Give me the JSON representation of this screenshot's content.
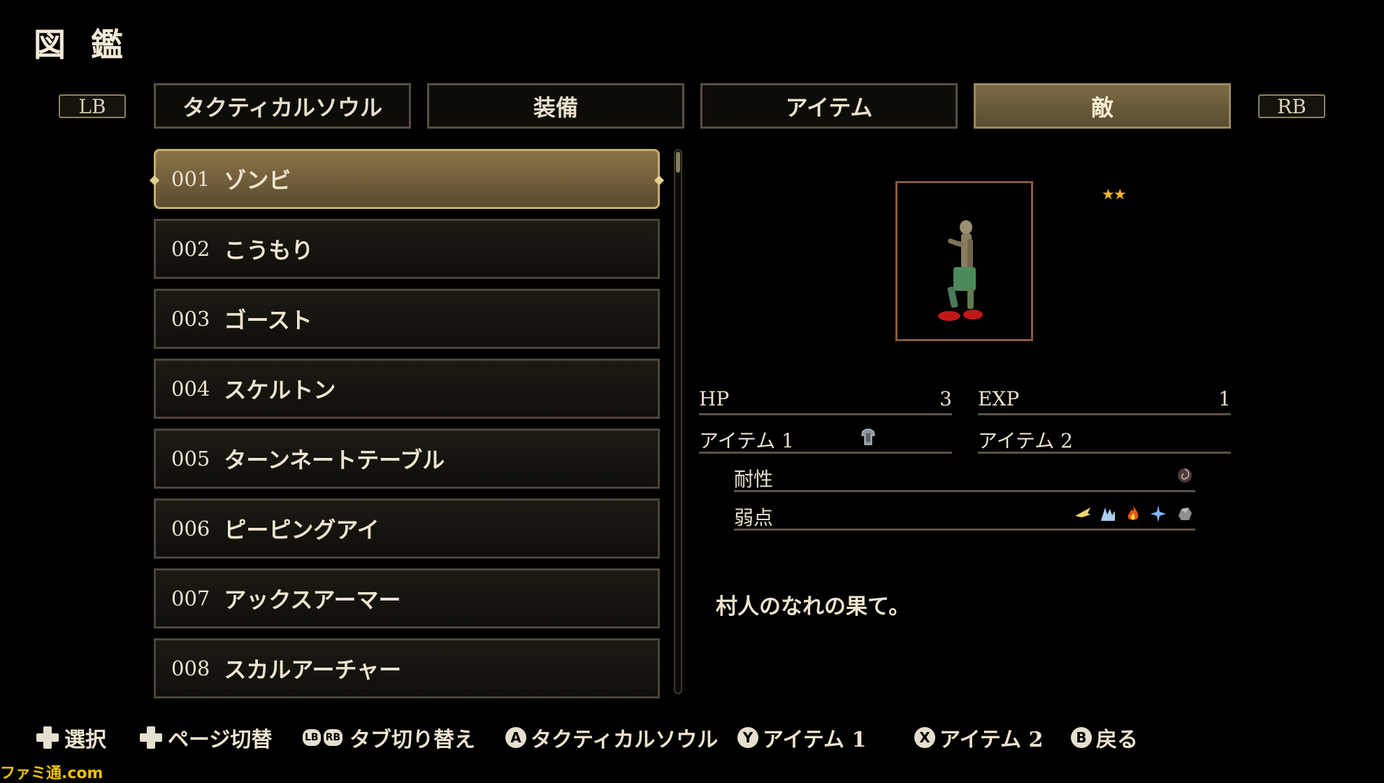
{
  "screen_title": "図 鑑",
  "bumpers": {
    "left": "LB",
    "right": "RB"
  },
  "tabs": [
    {
      "label": "タクティカルソウル"
    },
    {
      "label": "装備"
    },
    {
      "label": "アイテム"
    },
    {
      "label": "敵",
      "active": true
    }
  ],
  "list": [
    {
      "num": "001",
      "name": "ゾンビ",
      "selected": true
    },
    {
      "num": "002",
      "name": "こうもり"
    },
    {
      "num": "003",
      "name": "ゴースト"
    },
    {
      "num": "004",
      "name": "スケルトン"
    },
    {
      "num": "005",
      "name": "ターンネートテーブル"
    },
    {
      "num": "006",
      "name": "ピーピングアイ"
    },
    {
      "num": "007",
      "name": "アックスアーマー"
    },
    {
      "num": "008",
      "name": "スカルアーチャー"
    }
  ],
  "detail": {
    "rarity": "★★",
    "hp_label": "HP",
    "hp_value": "3",
    "exp_label": "EXP",
    "exp_value": "1",
    "item1_label": "アイテム 1",
    "item1_icon": "armor-icon",
    "item2_label": "アイテム 2",
    "resist_label": "耐性",
    "resist_icons": [
      "dark-swirl-icon"
    ],
    "weak_label": "弱点",
    "weak_icons": [
      "holy-wing-icon",
      "ice-shard-icon",
      "fire-icon",
      "star-burst-icon",
      "stone-icon"
    ],
    "description": "村人のなれの果て。"
  },
  "footer": {
    "select": "選択",
    "page": "ページ切替",
    "lb": "LB",
    "rb": "RB",
    "tab_switch": "タブ切り替え",
    "a_key": "A",
    "a_label": "タクティカルソウル",
    "y_key": "Y",
    "y_label": "アイテム 1",
    "x_key": "X",
    "x_label": "アイテム 2",
    "b_key": "B",
    "b_label": "戻る"
  },
  "watermark": "ファミ通.com",
  "colors": {
    "accent_gold": "#c8ad70",
    "star": "#f2b62b",
    "portrait_border": "#8b5a3a"
  }
}
